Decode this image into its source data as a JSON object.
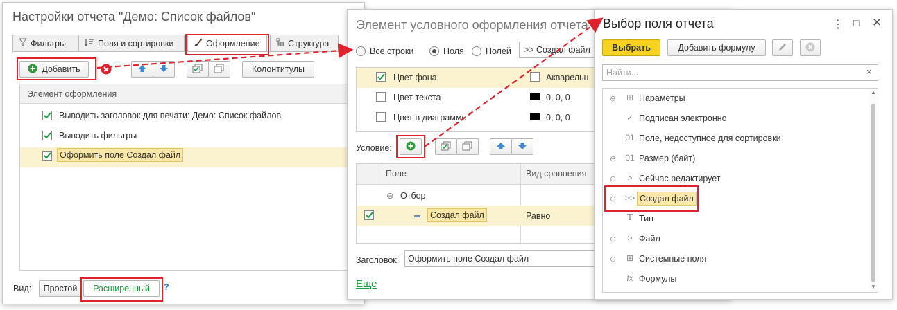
{
  "settings_window": {
    "title": "Настройки отчета \"Демо: Список файлов\"",
    "tabs": [
      {
        "label": "Фильтры",
        "icon": "filter-icon"
      },
      {
        "label": "Поля и сортировки",
        "icon": "fields-sort-icon"
      },
      {
        "label": "Оформление",
        "icon": "brush-icon"
      },
      {
        "label": "Структура",
        "icon": "structure-icon"
      }
    ],
    "toolbar": {
      "add_label": "Добавить",
      "headers_footers_label": "Колонтитулы"
    },
    "grid_header": "Элемент оформления",
    "items": [
      {
        "label": "Выводить заголовок для печати: Демо: Список файлов",
        "checked": true
      },
      {
        "label": "Выводить фильтры",
        "checked": true
      },
      {
        "label": "Оформить поле Создал файл",
        "checked": true
      }
    ],
    "view_label": "Вид:",
    "view_simple": "Простой",
    "view_extended": "Расширенный",
    "help": "?"
  },
  "cond_window": {
    "title": "Элемент условного оформления отчета",
    "radios": [
      {
        "label": "Все строки",
        "selected": false
      },
      {
        "label": "Поля",
        "selected": true
      },
      {
        "label": "Полей",
        "selected": false
      }
    ],
    "fields_value": "Создал файл",
    "appearance": [
      {
        "label": "Цвет фона",
        "checked": true,
        "value": "Акварельн",
        "value_checked": false
      },
      {
        "label": "Цвет текста",
        "checked": false,
        "value": "0, 0, 0"
      },
      {
        "label": "Цвет в диаграмме",
        "checked": false,
        "value": "0, 0, 0"
      }
    ],
    "condition_label": "Условие:",
    "filter_cols": [
      "Поле",
      "Вид сравнения"
    ],
    "filter_group": "Отбор",
    "filter_row": {
      "field": "Создал файл",
      "comparison": "Равно",
      "checked": true
    },
    "heading_label": "Заголовок:",
    "heading_value": "Оформить поле Создал файл",
    "more_link": "Еще"
  },
  "field_window": {
    "title": "Выбор поля отчета",
    "select_label": "Выбрать",
    "add_formula_label": "Добавить формулу",
    "search_placeholder": "Найти...",
    "items": [
      {
        "label": "Параметры",
        "icon": "grid-icon",
        "glyph": "⊞",
        "expandable": true
      },
      {
        "label": "Подписан электронно",
        "icon": "check-icon",
        "glyph": "✓",
        "expandable": false
      },
      {
        "label": "Поле, недоступное для сортировки",
        "icon": "number-icon",
        "glyph": "01",
        "expandable": false
      },
      {
        "label": "Размер (байт)",
        "icon": "number-icon",
        "glyph": "01",
        "expandable": true
      },
      {
        "label": "Сейчас редактирует",
        "icon": "reference-icon",
        "glyph": ">",
        "expandable": true
      },
      {
        "label": "Создал файл",
        "icon": "reference-icon",
        "glyph": ">>",
        "expandable": true,
        "selected": true
      },
      {
        "label": "Тип",
        "icon": "text-icon",
        "glyph": "T",
        "expandable": false
      },
      {
        "label": "Файл",
        "icon": "reference-icon",
        "glyph": ">",
        "expandable": true
      },
      {
        "label": "Системные поля",
        "icon": "grid-icon",
        "glyph": "⊞",
        "expandable": true
      },
      {
        "label": "Формулы",
        "icon": "formula-icon",
        "glyph": "fx",
        "expandable": false
      }
    ]
  },
  "colors": {
    "accent_red": "#e0222d",
    "highlight": "#fbe7a7",
    "select_button": "#f5d320",
    "green": "#1a9f3c"
  }
}
